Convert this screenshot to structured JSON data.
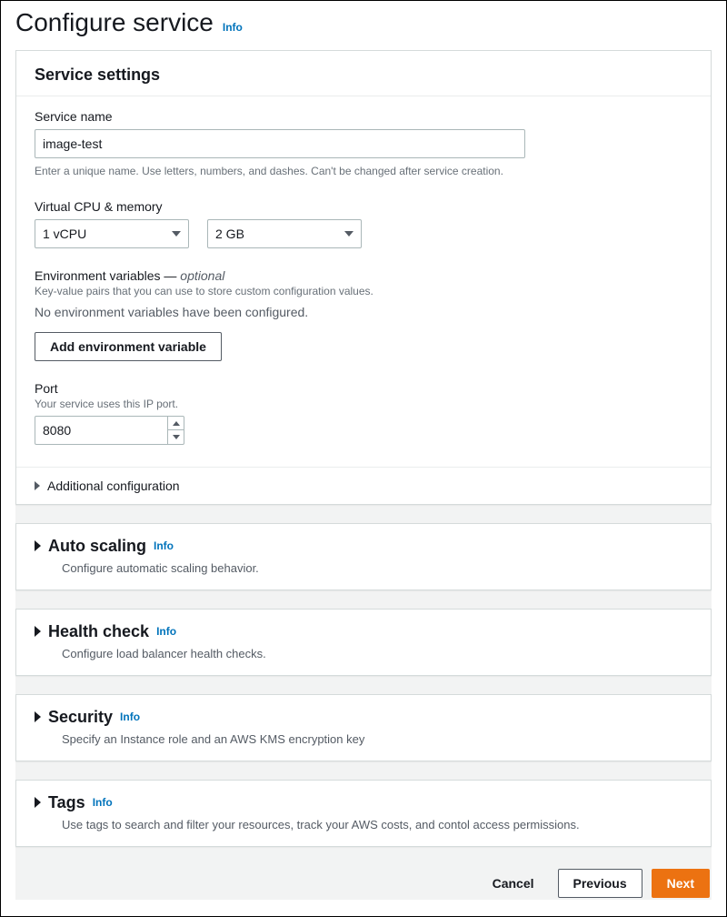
{
  "page": {
    "title": "Configure service",
    "info": "Info"
  },
  "serviceSettings": {
    "heading": "Service settings",
    "serviceName": {
      "label": "Service name",
      "value": "image-test",
      "hint": "Enter a unique name. Use letters, numbers, and dashes. Can't be changed after service creation."
    },
    "vcpuMemory": {
      "label": "Virtual CPU & memory",
      "vcpu": "1 vCPU",
      "memory": "2 GB"
    },
    "envVars": {
      "label": "Environment variables —",
      "optional": "optional",
      "hint": "Key-value pairs that you can use to store custom configuration values.",
      "empty": "No environment variables have been configured.",
      "addButton": "Add environment variable"
    },
    "port": {
      "label": "Port",
      "hint": "Your service uses this IP port.",
      "value": "8080"
    },
    "additionalConfig": "Additional configuration"
  },
  "sections": {
    "autoScaling": {
      "title": "Auto scaling",
      "info": "Info",
      "desc": "Configure automatic scaling behavior."
    },
    "healthCheck": {
      "title": "Health check",
      "info": "Info",
      "desc": "Configure load balancer health checks."
    },
    "security": {
      "title": "Security",
      "info": "Info",
      "desc": "Specify an Instance role and an AWS KMS encryption key"
    },
    "tags": {
      "title": "Tags",
      "info": "Info",
      "desc": "Use tags to search and filter your resources, track your AWS costs, and contol access permissions."
    }
  },
  "footer": {
    "cancel": "Cancel",
    "previous": "Previous",
    "next": "Next"
  }
}
